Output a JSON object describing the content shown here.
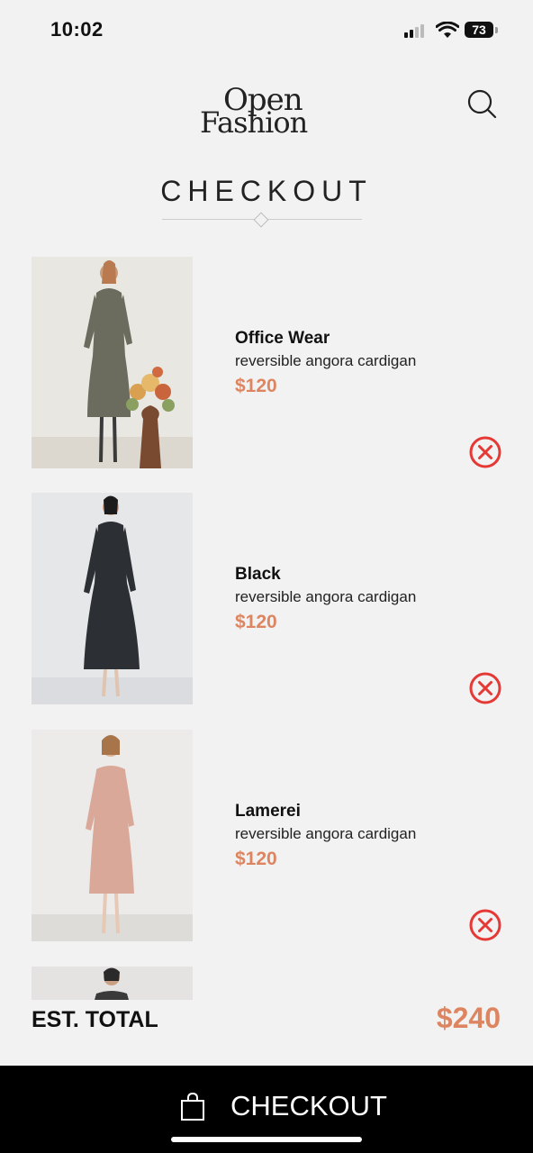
{
  "status": {
    "time": "10:02",
    "battery": "73"
  },
  "header": {
    "logo_line1": "Open",
    "logo_line2": "Fashion",
    "title": "CHECKOUT"
  },
  "items": [
    {
      "name": "Office Wear",
      "description": "reversible angora cardigan",
      "price": "$120",
      "image": "woman in grey coat dress with flowers"
    },
    {
      "name": "Black",
      "description": "reversible angora cardigan",
      "price": "$120",
      "image": "woman in black coat dress"
    },
    {
      "name": "Lamerei",
      "description": "reversible angora cardigan",
      "price": "$120",
      "image": "woman in pink dress"
    }
  ],
  "total": {
    "label": "EST. TOTAL",
    "value": "$240"
  },
  "checkout_button": {
    "label": "CHECKOUT"
  },
  "colors": {
    "accent": "#dd8560",
    "remove": "#e53935",
    "bar": "#000000"
  }
}
